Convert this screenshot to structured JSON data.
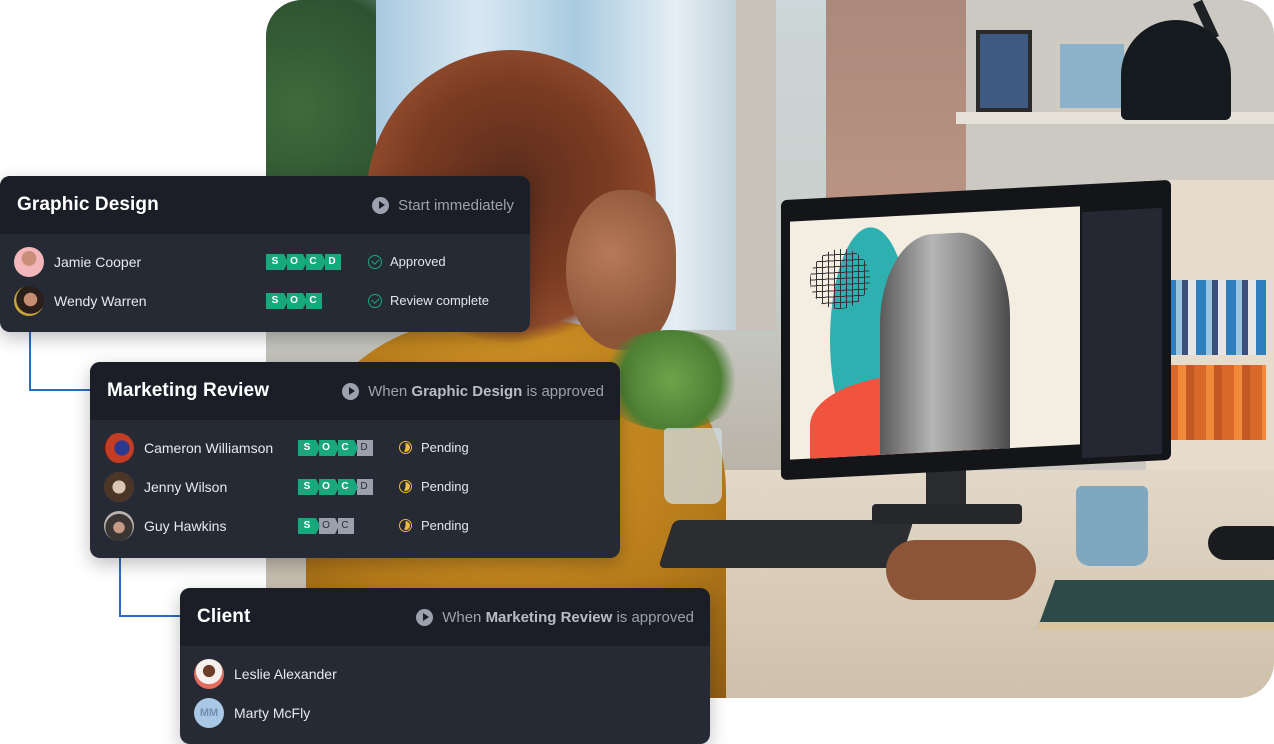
{
  "workflow": {
    "steps": [
      {
        "title": "Graphic Design",
        "trigger": {
          "prefix": "Start immediately",
          "bold": "",
          "suffix": ""
        },
        "reviewers": [
          {
            "name": "Jamie Cooper",
            "stages": [
              {
                "letter": "S",
                "done": true
              },
              {
                "letter": "O",
                "done": true
              },
              {
                "letter": "C",
                "done": true
              },
              {
                "letter": "D",
                "done": true
              }
            ],
            "status": "Approved",
            "status_icon": "check-circle-icon"
          },
          {
            "name": "Wendy Warren",
            "stages": [
              {
                "letter": "S",
                "done": true
              },
              {
                "letter": "O",
                "done": true
              },
              {
                "letter": "C",
                "done": true
              }
            ],
            "status": "Review complete",
            "status_icon": "check-circle-icon"
          }
        ]
      },
      {
        "title": "Marketing Review",
        "trigger": {
          "prefix": "When ",
          "bold": "Graphic Design",
          "suffix": " is approved"
        },
        "reviewers": [
          {
            "name": "Cameron Williamson",
            "stages": [
              {
                "letter": "S",
                "done": true
              },
              {
                "letter": "O",
                "done": true
              },
              {
                "letter": "C",
                "done": true
              },
              {
                "letter": "D",
                "done": false
              }
            ],
            "status": "Pending",
            "status_icon": "pending-clock-icon"
          },
          {
            "name": "Jenny Wilson",
            "stages": [
              {
                "letter": "S",
                "done": true
              },
              {
                "letter": "O",
                "done": true
              },
              {
                "letter": "C",
                "done": true
              },
              {
                "letter": "D",
                "done": false
              }
            ],
            "status": "Pending",
            "status_icon": "pending-clock-icon"
          },
          {
            "name": "Guy Hawkins",
            "stages": [
              {
                "letter": "S",
                "done": true
              },
              {
                "letter": "O",
                "done": false
              },
              {
                "letter": "C",
                "done": false
              }
            ],
            "status": "Pending",
            "status_icon": "pending-clock-icon"
          }
        ]
      },
      {
        "title": "Client",
        "trigger": {
          "prefix": "When ",
          "bold": "Marketing Review",
          "suffix": " is approved"
        },
        "reviewers": [
          {
            "name": "Leslie Alexander"
          },
          {
            "name": "Marty McFly",
            "initials": "MM"
          }
        ]
      }
    ]
  },
  "colors": {
    "card_bg": "#262a35",
    "card_header_bg": "#1b1e27",
    "stage_done": "#19a87c",
    "stage_todo": "#9aa0ad",
    "approved_green": "#19a87c",
    "pending_yellow": "#f0b93a",
    "connector_blue": "#2c6dc4"
  }
}
